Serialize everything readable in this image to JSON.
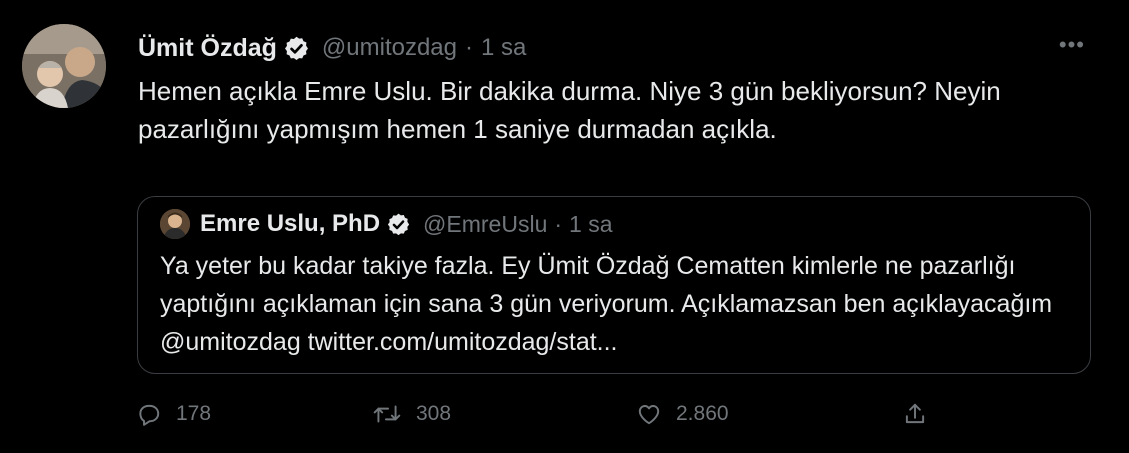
{
  "tweet": {
    "author_name": "Ümit Özdağ",
    "handle": "@umitozdag",
    "separator": "·",
    "time": "1 sa",
    "more_label": "•••",
    "text": "Hemen açıkla Emre Uslu. Bir dakika durma. Niye 3 gün bekliyorsun? Neyin pazarlığını yapmışım hemen 1 saniye durmadan açıkla.",
    "verified": true,
    "verified_color": "#e7e9ea"
  },
  "quoted_tweet": {
    "author_name": "Emre Uslu, PhD",
    "handle": "@EmreUslu",
    "separator": "·",
    "time": "1 sa",
    "text": "Ya yeter bu kadar takiye fazla.  Ey Ümit Özdağ Cematten kimlerle ne pazarlığı yaptığını açıklaman için sana 3 gün veriyorum. Açıklamazsan ben açıklayacağım @umitozdag twitter.com/umitozdag/stat...",
    "verified": true
  },
  "actions": {
    "reply": {
      "icon": "reply-icon",
      "count": "178"
    },
    "retweet": {
      "icon": "retweet-icon",
      "count": "308"
    },
    "like": {
      "icon": "like-icon",
      "count": "2.860"
    },
    "share": {
      "icon": "share-icon"
    }
  },
  "colors": {
    "background": "#000000",
    "primary_text": "#e7e9ea",
    "secondary_text": "#71767b",
    "border": "#3a3d41"
  }
}
